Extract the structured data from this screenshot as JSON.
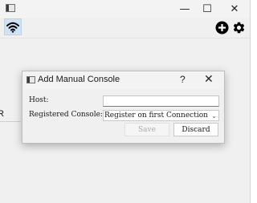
{
  "main_window": {
    "title": "",
    "controls": {
      "minimize": "—",
      "maximize": "☐",
      "close": "✕"
    },
    "toolbar": {
      "wifi_icon": "wifi-icon",
      "add_icon": "add-circle-icon",
      "settings_icon": "gear-icon"
    },
    "background_text": "R"
  },
  "dialog": {
    "title": "Add Manual Console",
    "help": "?",
    "close": "✕",
    "host_label": "Host:",
    "host_value": "",
    "registered_label": "Registered Console:",
    "registered_value": "Register on first Connection",
    "save_label": "Save",
    "save_enabled": false,
    "discard_label": "Discard"
  },
  "colors": {
    "accent": "#cfe3f5",
    "window_bg": "#f0f0f0",
    "disabled_text": "#a9a9a9"
  }
}
